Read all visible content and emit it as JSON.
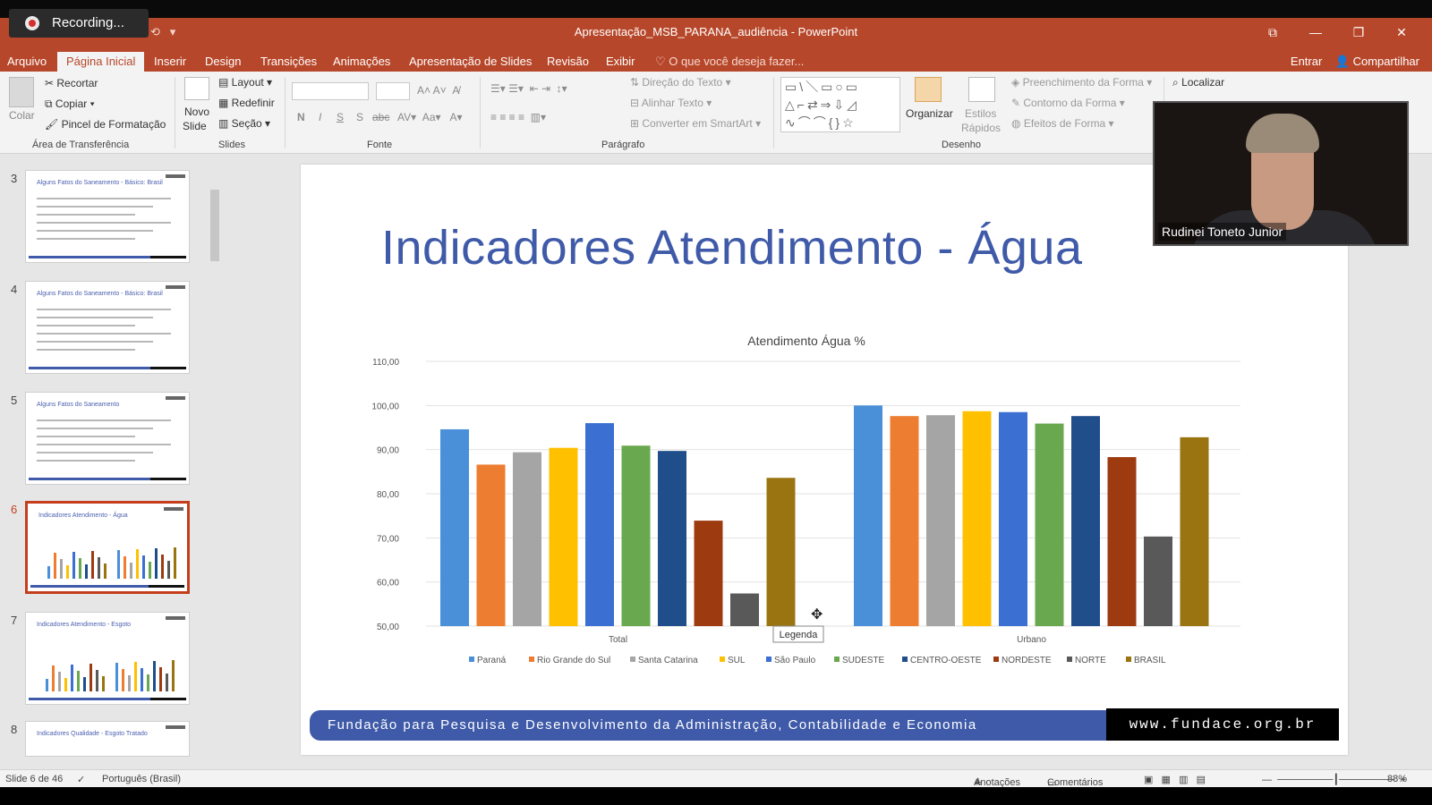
{
  "recording": {
    "label": "Recording..."
  },
  "window": {
    "title": "Apresentação_MSB_PARANA_audiência - PowerPoint",
    "controls": [
      "⧉",
      "—",
      "❐",
      "✕"
    ]
  },
  "tabs": [
    "Arquivo",
    "Página Inicial",
    "Inserir",
    "Design",
    "Transições",
    "Animações",
    "Apresentação de Slides",
    "Revisão",
    "Exibir",
    "O que você deseja fazer..."
  ],
  "tabs_right": {
    "signin": "Entrar",
    "share": "Compartilhar"
  },
  "ribbon": {
    "clipboard": {
      "paste": "Colar",
      "cut": "Recortar",
      "copy": "Copiar",
      "format_painter": "Pincel de Formatação",
      "label": "Área de Transferência"
    },
    "slides": {
      "new_slide": "Novo",
      "new_slide2": "Slide",
      "layout": "Layout",
      "reset": "Redefinir",
      "section": "Seção",
      "label": "Slides"
    },
    "font": {
      "label": "Fonte",
      "bold": "N",
      "italic": "I",
      "underline": "S",
      "shadow": "S",
      "strike": "abc"
    },
    "paragraph": {
      "text_direction": "Direção do Texto",
      "align_text": "Alinhar Texto",
      "smartart": "Converter em SmartArt",
      "label": "Parágrafo"
    },
    "drawing": {
      "arrange": "Organizar",
      "quick_styles": "Estilos",
      "quick_styles2": "Rápidos",
      "fill": "Preenchimento da Forma",
      "outline": "Contorno da Forma",
      "effects": "Efeitos de Forma",
      "label": "Desenho"
    },
    "editing": {
      "find": "Localizar"
    }
  },
  "thumbnails": [
    {
      "num": "3",
      "title": "Alguns Fatos do Saneamento - Básico: Brasil"
    },
    {
      "num": "4",
      "title": "Alguns Fatos do Saneamento - Básico: Brasil"
    },
    {
      "num": "5",
      "title": "Alguns Fatos do Saneamento"
    },
    {
      "num": "6",
      "title": "Indicadores Atendimento - Água"
    },
    {
      "num": "7",
      "title": "Indicadores Atendimento - Esgoto"
    },
    {
      "num": "8",
      "title": "Indicadores Qualidade - Esgoto Tratado"
    }
  ],
  "slide": {
    "title": "Indicadores Atendimento  -  Água",
    "footer": "Fundação para Pesquisa e Desenvolvimento da Administração, Contabilidade e Economia",
    "url": "www.fundace.org.br",
    "tooltip": "Legenda"
  },
  "chart_data": {
    "type": "bar",
    "title": "Atendimento Água %",
    "categories": [
      "Total",
      "Urbano"
    ],
    "ylim": [
      50,
      110
    ],
    "yticks": [
      "50,00",
      "60,00",
      "70,00",
      "80,00",
      "90,00",
      "100,00",
      "110,00"
    ],
    "series": [
      {
        "name": "Paraná",
        "color": "#4a90d9",
        "values": [
          94.6,
          100.0
        ]
      },
      {
        "name": "Rio Grande do Sul",
        "color": "#ed7d31",
        "values": [
          86.6,
          97.6
        ]
      },
      {
        "name": "Santa Catarina",
        "color": "#a5a5a5",
        "values": [
          89.4,
          97.8
        ]
      },
      {
        "name": "SUL",
        "color": "#ffc000",
        "values": [
          90.4,
          98.7
        ]
      },
      {
        "name": "São Paulo",
        "color": "#3b6fd1",
        "values": [
          96.0,
          98.5
        ]
      },
      {
        "name": "SUDESTE",
        "color": "#6aa84f",
        "values": [
          90.9,
          95.9
        ]
      },
      {
        "name": "CENTRO-OESTE",
        "color": "#1f4e8a",
        "values": [
          89.7,
          97.6
        ]
      },
      {
        "name": "NORDESTE",
        "color": "#9e3a10",
        "values": [
          73.9,
          88.3
        ]
      },
      {
        "name": "NORTE",
        "color": "#595959",
        "values": [
          57.4,
          70.3
        ]
      },
      {
        "name": "BRASIL",
        "color": "#9a7410",
        "values": [
          83.6,
          92.8
        ]
      }
    ],
    "legend_position": "bottom"
  },
  "webcam": {
    "name": "Rudinei Toneto Junior"
  },
  "status": {
    "slide": "Slide 6 de 46",
    "language": "Português (Brasil)",
    "notes": "Anotações",
    "comments": "Comentários",
    "zoom": "88%"
  }
}
